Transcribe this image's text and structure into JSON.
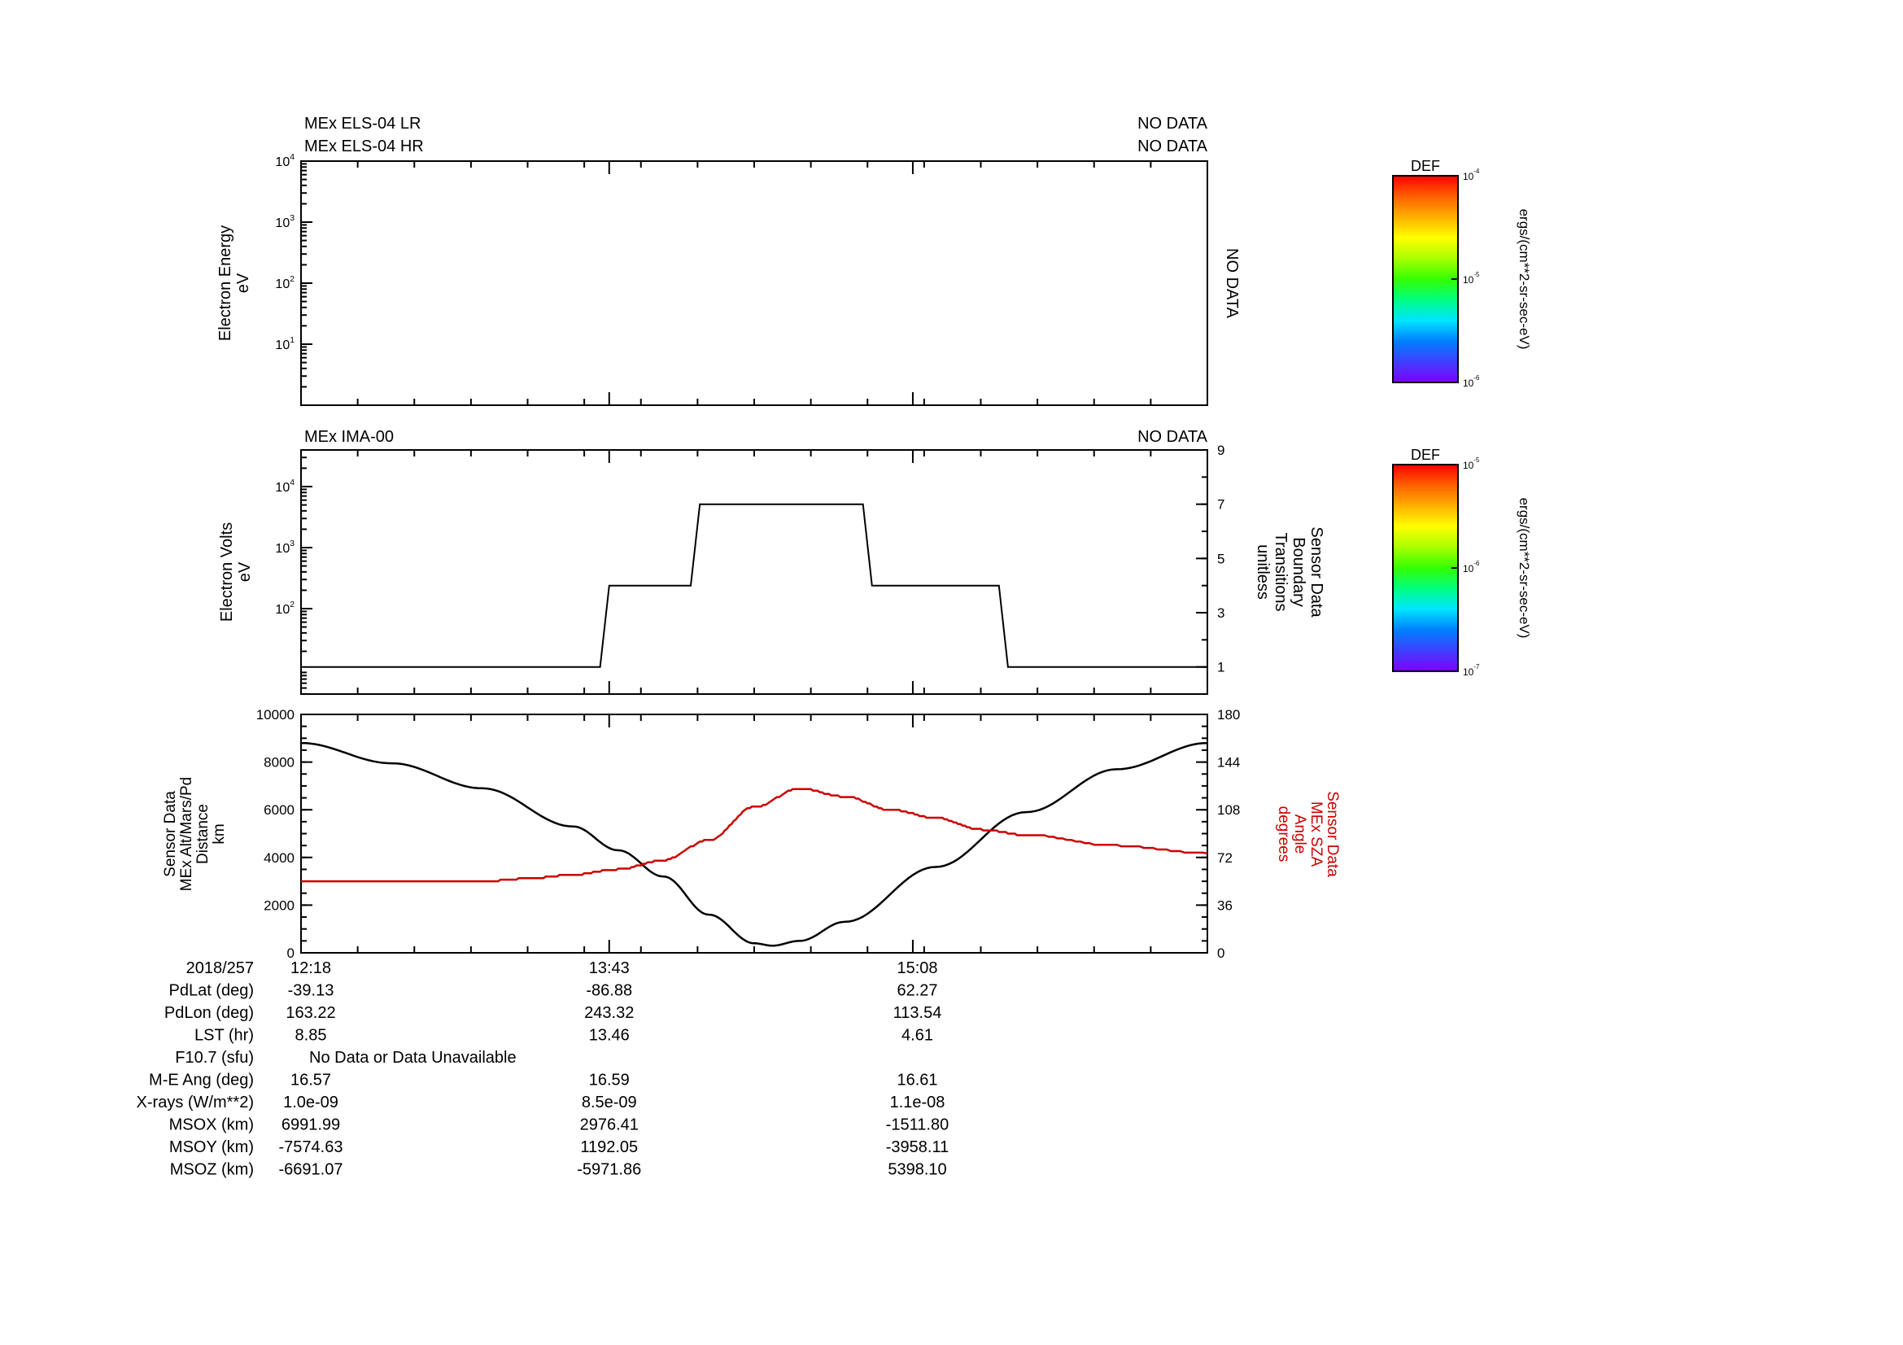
{
  "colors": {
    "axis": "#000000",
    "sza_series": "#cc0000",
    "distance_series": "#000000",
    "colorbar_stops": [
      "#7f00ff",
      "#3f3fff",
      "#0080ff",
      "#00e5ff",
      "#00ff80",
      "#33ff00",
      "#aaff00",
      "#ffff00",
      "#ffb000",
      "#ff6000",
      "#ff0000"
    ]
  },
  "panel1": {
    "title_left_1": "MEx ELS-04 LR",
    "title_left_2": "MEx ELS-04 HR",
    "title_right_1": "NO DATA",
    "title_right_2": "NO DATA",
    "ylabel_1": "Electron Energy",
    "ylabel_2": "eV",
    "nodata_vertical": "NO DATA",
    "yticks": [
      {
        "base": "10",
        "exp": "4"
      },
      {
        "base": "10",
        "exp": "3"
      },
      {
        "base": "10",
        "exp": "2"
      },
      {
        "base": "10",
        "exp": "1"
      }
    ]
  },
  "panel2": {
    "title_left": "MEx IMA-00",
    "title_right": "NO DATA",
    "ylabel_1": "Electron Volts",
    "ylabel_2": "eV",
    "yticks": [
      {
        "base": "10",
        "exp": "4"
      },
      {
        "base": "10",
        "exp": "3"
      },
      {
        "base": "10",
        "exp": "2"
      }
    ],
    "right_label_lines": [
      "Sensor Data",
      "Boundary",
      "Transitions",
      "unitless"
    ],
    "right_ticks": [
      "9",
      "7",
      "5",
      "3",
      "1"
    ]
  },
  "panel3": {
    "left_label_lines": [
      "Sensor Data",
      "MEx Alt/Mars/Pd",
      "Distance",
      "km"
    ],
    "right_label_lines": [
      "Sensor Data",
      "MEx SZA",
      "Angle",
      "degrees"
    ],
    "left_ticks": [
      "10000",
      "8000",
      "6000",
      "4000",
      "2000",
      "0"
    ],
    "right_ticks": [
      "180",
      "144",
      "108",
      "72",
      "36",
      "0"
    ]
  },
  "colorbar1": {
    "title": "DEF",
    "unit": "ergs/(cm**2-sr-sec-eV)",
    "ticks": [
      {
        "base": "10",
        "exp": "-4"
      },
      {
        "base": "10",
        "exp": "-5"
      },
      {
        "base": "10",
        "exp": "-6"
      }
    ]
  },
  "colorbar2": {
    "title": "DEF",
    "unit": "ergs/(cm**2-sr-sec-eV)",
    "ticks": [
      {
        "base": "10",
        "exp": "-5"
      },
      {
        "base": "10",
        "exp": "-6"
      },
      {
        "base": "10",
        "exp": "-7"
      }
    ]
  },
  "ephemeris": {
    "rows": [
      {
        "label": "2018/257",
        "values": [
          "12:18",
          "13:43",
          "15:08"
        ]
      },
      {
        "label": "PdLat (deg)",
        "values": [
          "-39.13",
          "-86.88",
          "62.27"
        ]
      },
      {
        "label": "PdLon (deg)",
        "values": [
          "163.22",
          "243.32",
          "113.54"
        ]
      },
      {
        "label": "LST (hr)",
        "values": [
          "8.85",
          "13.46",
          "4.61"
        ]
      },
      {
        "label": "F10.7 (sfu)",
        "values": [
          "No Data or Data Unavailable",
          "",
          ""
        ]
      },
      {
        "label": "M-E Ang (deg)",
        "values": [
          "16.57",
          "16.59",
          "16.61"
        ]
      },
      {
        "label": "X-rays (W/m**2)",
        "values": [
          "1.0e-09",
          "8.5e-09",
          "1.1e-08"
        ]
      },
      {
        "label": "MSOX (km)",
        "values": [
          "6991.99",
          "2976.41",
          "-1511.80"
        ]
      },
      {
        "label": "MSOY (km)",
        "values": [
          "-7574.63",
          "1192.05",
          "-3958.11"
        ]
      },
      {
        "label": "MSOZ (km)",
        "values": [
          "-6691.07",
          "-5971.86",
          "5398.10"
        ]
      }
    ]
  },
  "chart_data": [
    {
      "type": "heatmap",
      "panel": "MEx ELS-04",
      "status": "NO DATA",
      "ylabel": "Electron Energy eV",
      "yscale": "log",
      "ylim": [
        1,
        10000
      ]
    },
    {
      "type": "line",
      "panel": "MEx IMA-00",
      "status": "NO DATA",
      "ylabel": "Electron Volts eV",
      "yscale": "log",
      "right_axis": {
        "label": "Sensor Data Boundary Transitions unitless",
        "ylim": [
          0,
          9
        ]
      },
      "series": [
        {
          "name": "Sensor Data Boundary Transitions",
          "x": [
            0.0,
            0.33,
            0.34,
            0.43,
            0.44,
            0.62,
            0.63,
            0.77,
            0.78,
            1.0
          ],
          "y": [
            1,
            1,
            4,
            4,
            7,
            7,
            4,
            4,
            1,
            1
          ]
        }
      ]
    },
    {
      "type": "line",
      "panel": "Distance / SZA",
      "x_ticks": [
        "12:18",
        "13:43",
        "15:08"
      ],
      "left_axis": {
        "label": "Sensor Data MEx Alt/Mars/Pd Distance km",
        "ylim": [
          0,
          10000
        ]
      },
      "right_axis": {
        "label": "Sensor Data MEx SZA Angle degrees",
        "ylim": [
          0,
          180
        ]
      },
      "series": [
        {
          "name": "MEx Alt/Mars/Pd Distance",
          "axis": "left",
          "x": [
            0.0,
            0.1,
            0.2,
            0.3,
            0.35,
            0.4,
            0.45,
            0.5,
            0.52,
            0.55,
            0.6,
            0.7,
            0.8,
            0.9,
            1.0
          ],
          "y": [
            8800,
            7950,
            6900,
            5300,
            4300,
            3200,
            1600,
            400,
            300,
            500,
            1300,
            3600,
            5900,
            7700,
            8800
          ]
        },
        {
          "name": "MEx SZA Angle",
          "axis": "right",
          "x": [
            0.0,
            0.2,
            0.25,
            0.3,
            0.35,
            0.4,
            0.45,
            0.5,
            0.55,
            0.6,
            0.65,
            0.7,
            0.75,
            0.8,
            0.9,
            1.0
          ],
          "y": [
            54,
            54,
            56,
            59,
            63,
            70,
            85,
            110,
            124,
            118,
            108,
            102,
            93,
            89,
            81,
            75
          ]
        }
      ]
    }
  ]
}
